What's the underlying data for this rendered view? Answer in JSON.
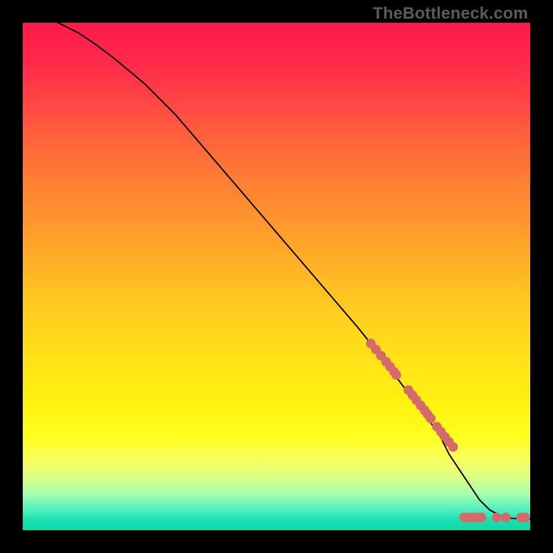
{
  "watermark": "TheBottleneck.com",
  "chart_data": {
    "type": "line",
    "title": "",
    "xlabel": "",
    "ylabel": "",
    "xlim": [
      0,
      100
    ],
    "ylim": [
      0,
      100
    ],
    "grid": false,
    "legend": false,
    "series": [
      {
        "name": "curve",
        "style": "line",
        "color": "#000000",
        "x": [
          7,
          9,
          11,
          14,
          18,
          24,
          30,
          36,
          42,
          48,
          54,
          60,
          66,
          70,
          73,
          76,
          79,
          82,
          84,
          86,
          88,
          90,
          92,
          95,
          100
        ],
        "y": [
          100,
          99,
          98,
          96,
          93,
          88,
          82,
          75,
          68,
          61,
          54,
          47,
          40,
          35,
          31,
          27,
          23,
          19,
          15,
          12,
          9,
          6,
          4,
          2.4,
          2.2
        ]
      },
      {
        "name": "points",
        "style": "scatter",
        "color": "#d66a6a",
        "radius": 7,
        "x": [
          68.6,
          69.6,
          70.6,
          71.6,
          72.4,
          73.2,
          73.6,
          76.0,
          76.8,
          77.6,
          78.4,
          79.2,
          79.8,
          80.4,
          81.6,
          82.4,
          83.2,
          84.0,
          84.8,
          87.0,
          87.8,
          88.6,
          89.2,
          89.8,
          90.4,
          93.4,
          95.2,
          98.2,
          99.0
        ],
        "y": [
          36.8,
          35.6,
          34.4,
          33.2,
          32.2,
          31.2,
          30.6,
          27.6,
          26.6,
          25.6,
          24.6,
          23.6,
          22.8,
          22.0,
          20.4,
          19.4,
          18.4,
          17.4,
          16.4,
          2.5,
          2.5,
          2.5,
          2.5,
          2.5,
          2.5,
          2.5,
          2.5,
          2.5,
          2.5
        ]
      }
    ]
  }
}
